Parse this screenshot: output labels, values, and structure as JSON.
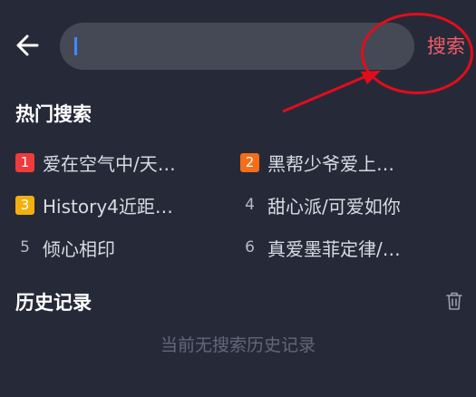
{
  "header": {
    "search_value": "",
    "search_button_label": "搜索"
  },
  "hot": {
    "title": "热门搜索",
    "items": [
      {
        "rank": "1",
        "label": "爱在空气中/天…",
        "badge_color": "#ef3b3b"
      },
      {
        "rank": "2",
        "label": "黑帮少爷爱上…",
        "badge_color": "#f36d1a"
      },
      {
        "rank": "3",
        "label": "History4近距…",
        "badge_color": "#f2b010"
      },
      {
        "rank": "4",
        "label": "甜心派/可爱如你",
        "badge_color": ""
      },
      {
        "rank": "5",
        "label": "倾心相印",
        "badge_color": ""
      },
      {
        "rank": "6",
        "label": "真爱墨菲定律/…",
        "badge_color": ""
      }
    ]
  },
  "history": {
    "title": "历史记录",
    "empty_text": "当前无搜索历史记录"
  },
  "colors": {
    "background": "#262a38",
    "search_box": "#454955",
    "accent": "#f25b6a",
    "annotation": "#e30c1c"
  },
  "icons": {
    "back": "arrow-left-icon",
    "trash": "trash-icon"
  }
}
